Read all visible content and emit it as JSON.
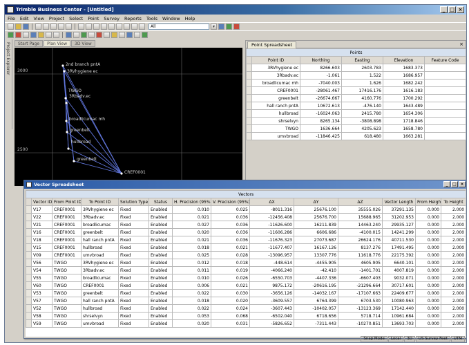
{
  "app": {
    "title": "Trimble Business Center - [Untitled]"
  },
  "menubar": [
    "File",
    "Edit",
    "View",
    "Project",
    "Select",
    "Point",
    "Survey",
    "Reports",
    "Tools",
    "Window",
    "Help"
  ],
  "toolbar": {
    "combo_value": "All"
  },
  "side_tab": "Project Explorer",
  "plan_tabs": [
    "Start Page",
    "Plan View",
    "3D View"
  ],
  "plan": {
    "axis_labels": [
      "3000",
      "2500"
    ],
    "points": [
      {
        "name": "2nd branch pntA"
      },
      {
        "name": "3RVhygiene ec"
      },
      {
        "name": "TWGO"
      },
      {
        "name": "3Rbadv.ec"
      },
      {
        "name": "broadlicumac mh"
      },
      {
        "name": "greenbelt"
      },
      {
        "name": "hullbroad"
      },
      {
        "name": "greenbelt"
      },
      {
        "name": "CREF0001"
      }
    ]
  },
  "points_panel": {
    "tab": "Point Spreadsheet",
    "group_header": "Points",
    "columns": [
      "Point ID",
      "Northing",
      "Easting",
      "Elevation",
      "Feature Code"
    ],
    "rows": [
      [
        "3RVhygiene ec",
        "8266.603",
        "2603.783",
        "1683.373",
        ""
      ],
      [
        "3Rbadv.ec",
        "-1.061",
        "1.522",
        "1686.957",
        ""
      ],
      [
        "broadlicumac mh",
        "-7040.003",
        "1.626",
        "1682.242",
        ""
      ],
      [
        "CREF0001",
        "-28061.467",
        "17416.176",
        "1616.183",
        ""
      ],
      [
        "greenbelt",
        "-26674.667",
        "4160.776",
        "1700.292",
        ""
      ],
      [
        "hall ranch pntA",
        "10672.613",
        "-476.140",
        "1643.489",
        ""
      ],
      [
        "hullbroad",
        "-16024.063",
        "2415.780",
        "1654.306",
        ""
      ],
      [
        "shrselvyn",
        "8265.134",
        "-3808.898",
        "1718.846",
        ""
      ],
      [
        "TWGO",
        "1636.664",
        "4205.623",
        "1658.780",
        ""
      ],
      [
        "umvbroad",
        "-11846.425",
        "618.480",
        "1663.281",
        ""
      ]
    ]
  },
  "vector_window": {
    "title": "Vector Spreadsheet",
    "group_header": "Vectors",
    "columns": [
      "Vector ID",
      "From Point ID",
      "To Point ID",
      "Solution Type",
      "Status",
      "H. Precision (95%)",
      "V. Precision (95%)",
      "ΔX",
      "ΔY",
      "ΔZ",
      "Vector Length",
      "From Height",
      "To Height"
    ],
    "rows": [
      [
        "V17",
        "CREF0001",
        "3RVhygiene ec",
        "Fixed",
        "Enabled",
        "0.010",
        "0.025",
        "-8011.316",
        "25676.100",
        "35555.026",
        "37291.135",
        "0.000",
        "2.000"
      ],
      [
        "V22",
        "CREF0001",
        "3Rbadv.ec",
        "Fixed",
        "Enabled",
        "0.021",
        "0.036",
        "-12456.408",
        "25676.700",
        "15688.965",
        "31202.953",
        "0.000",
        "2.000"
      ],
      [
        "V21",
        "CREF0001",
        "broadlicumac",
        "Fixed",
        "Enabled",
        "0.027",
        "0.036",
        "-11626.600",
        "16211.839",
        "14463.240",
        "29935.127",
        "0.000",
        "2.000"
      ],
      [
        "V16",
        "CREF0001",
        "greenbelt",
        "Fixed",
        "Enabled",
        "0.020",
        "0.036",
        "-11606.286",
        "6606.686",
        "-4100.015",
        "14241.299",
        "0.000",
        "2.000"
      ],
      [
        "V18",
        "CREF0001",
        "hall ranch pntA",
        "Fixed",
        "Enabled",
        "0.021",
        "0.036",
        "-11676.323",
        "27073.687",
        "26624.176",
        "40711.530",
        "0.000",
        "2.000"
      ],
      [
        "V15",
        "CREF0001",
        "hullbroad",
        "Fixed",
        "Enabled",
        "0.018",
        "0.021",
        "-11677.407",
        "16167.126",
        "8137.276",
        "17491.495",
        "0.000",
        "2.000"
      ],
      [
        "V09",
        "CREF0001",
        "umvbroad",
        "Fixed",
        "Enabled",
        "0.025",
        "0.028",
        "-13096.957",
        "13307.776",
        "11618.776",
        "22175.392",
        "0.000",
        "2.000"
      ],
      [
        "V56",
        "TWGO",
        "3RVhygiene ec",
        "Fixed",
        "Enabled",
        "0.012",
        "0.018",
        "-448.614",
        "-4455.905",
        "4605.905",
        "6640.101",
        "0.000",
        "2.000"
      ],
      [
        "V54",
        "TWGO",
        "3Rbadv.ec",
        "Fixed",
        "Enabled",
        "0.011",
        "0.019",
        "-4066.240",
        "-42.410",
        "-1401.701",
        "4007.819",
        "0.000",
        "2.000"
      ],
      [
        "V55",
        "TWGO",
        "broadlicumac",
        "Fixed",
        "Enabled",
        "0.010",
        "0.026",
        "-6550.703",
        "-4407.336",
        "-6607.403",
        "9032.071",
        "0.000",
        "2.000"
      ],
      [
        "V60",
        "TWGO",
        "CREF0001",
        "Fixed",
        "Enabled",
        "0.006",
        "0.021",
        "9875.172",
        "-20616.195",
        "-21296.664",
        "30717.601",
        "0.000",
        "2.000"
      ],
      [
        "V53",
        "TWGO",
        "greenbelt",
        "Fixed",
        "Enabled",
        "0.022",
        "0.030",
        "-3656.126",
        "-14032.167",
        "-17107.663",
        "22409.677",
        "0.000",
        "2.000"
      ],
      [
        "V57",
        "TWGO",
        "hall ranch pntA",
        "Fixed",
        "Enabled",
        "0.018",
        "0.020",
        "-3609.557",
        "6764.399",
        "6703.530",
        "10080.963",
        "0.000",
        "2.000"
      ],
      [
        "V52",
        "TWGO",
        "hullbroad",
        "Fixed",
        "Enabled",
        "0.022",
        "0.024",
        "-3607.443",
        "-10402.057",
        "-13123.369",
        "17142.440",
        "0.000",
        "2.000"
      ],
      [
        "V58",
        "TWGO",
        "shrselvyn",
        "Fixed",
        "Enabled",
        "0.053",
        "0.068",
        "-6502.040",
        "6718.656",
        "5718.714",
        "10961.684",
        "0.000",
        "2.000"
      ],
      [
        "V59",
        "TWGO",
        "umvbroad",
        "Fixed",
        "Enabled",
        "0.020",
        "0.031",
        "-5826.652",
        "-7311.443",
        "-10270.851",
        "13693.703",
        "0.000",
        "2.000"
      ]
    ]
  },
  "statusbar": [
    "Snap Mode",
    "Local",
    "3D",
    "US Survey Feet",
    "UTM"
  ]
}
